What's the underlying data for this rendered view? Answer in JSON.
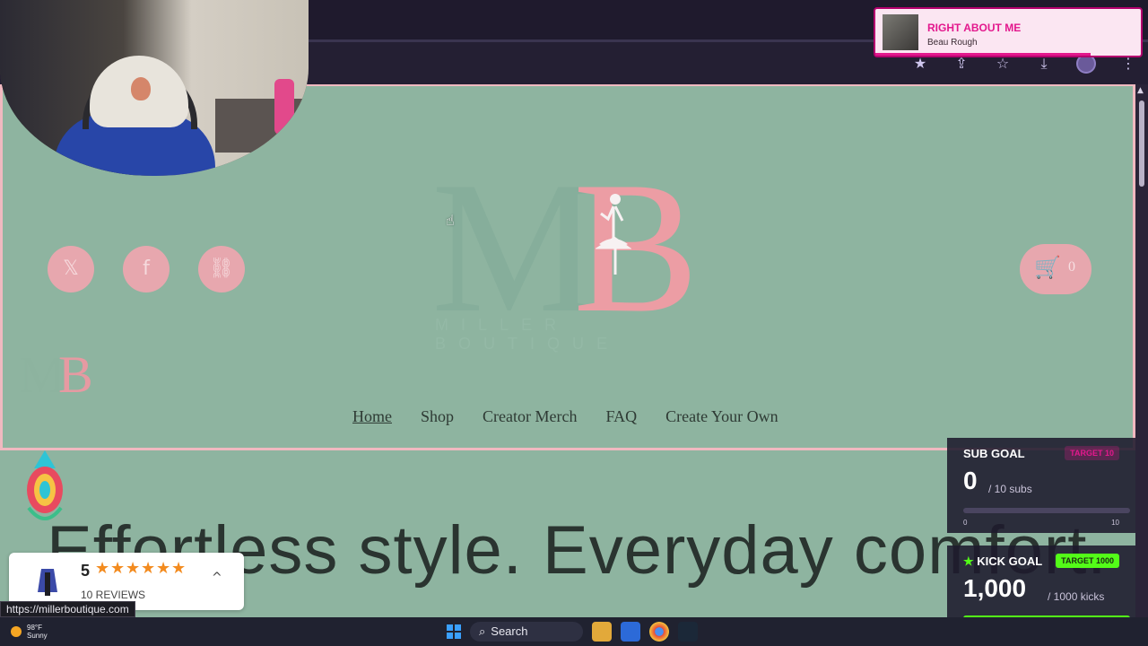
{
  "browser": {
    "toolbar_icons": [
      "star-filled-icon",
      "share-icon",
      "bookmark-star-icon",
      "download-icon",
      "profile-avatar",
      "kebab-menu-icon"
    ]
  },
  "site": {
    "logo_sub": "MILLER BOUTIQUE",
    "social": [
      {
        "name": "x-twitter-icon",
        "glyph": "𝕏"
      },
      {
        "name": "facebook-icon",
        "glyph": "f"
      },
      {
        "name": "link-icon",
        "glyph": "⛓"
      }
    ],
    "cart_count": "0",
    "nav": [
      {
        "label": "Home",
        "active": true
      },
      {
        "label": "Shop",
        "active": false
      },
      {
        "label": "Creator Merch",
        "active": false
      },
      {
        "label": "FAQ",
        "active": false
      },
      {
        "label": "Create Your Own",
        "active": false
      }
    ],
    "hero_text": "Effortless style. Everyday comfort."
  },
  "reviews_widget": {
    "score": "5",
    "stars": 5,
    "count_label": "10 REVIEWS"
  },
  "status_url": "https://millerboutique.com",
  "overlays": {
    "now_playing": {
      "title": "RIGHT ABOUT ME",
      "artist": "Beau Rough"
    },
    "sub_goal": {
      "label": "SUB GOAL",
      "tag": "TARGET 10",
      "current": "0",
      "unit": "/ 10 subs",
      "min": "0",
      "max": "10",
      "progress": 0
    },
    "kick_goal": {
      "label": "KICK GOAL",
      "tag": "TARGET 1000",
      "current": "1,000",
      "unit": "/ 1000 kicks",
      "min": "0",
      "max": "1000",
      "progress": 1.0
    }
  },
  "taskbar": {
    "weather_temp": "98°F",
    "weather_cond": "Sunny",
    "search_label": "Search"
  },
  "colors": {
    "page_bg": "#8eb4a0",
    "brand_pink": "#e7a7ae",
    "kick_green": "#53fc18",
    "overlay_magenta": "#e3188d"
  }
}
